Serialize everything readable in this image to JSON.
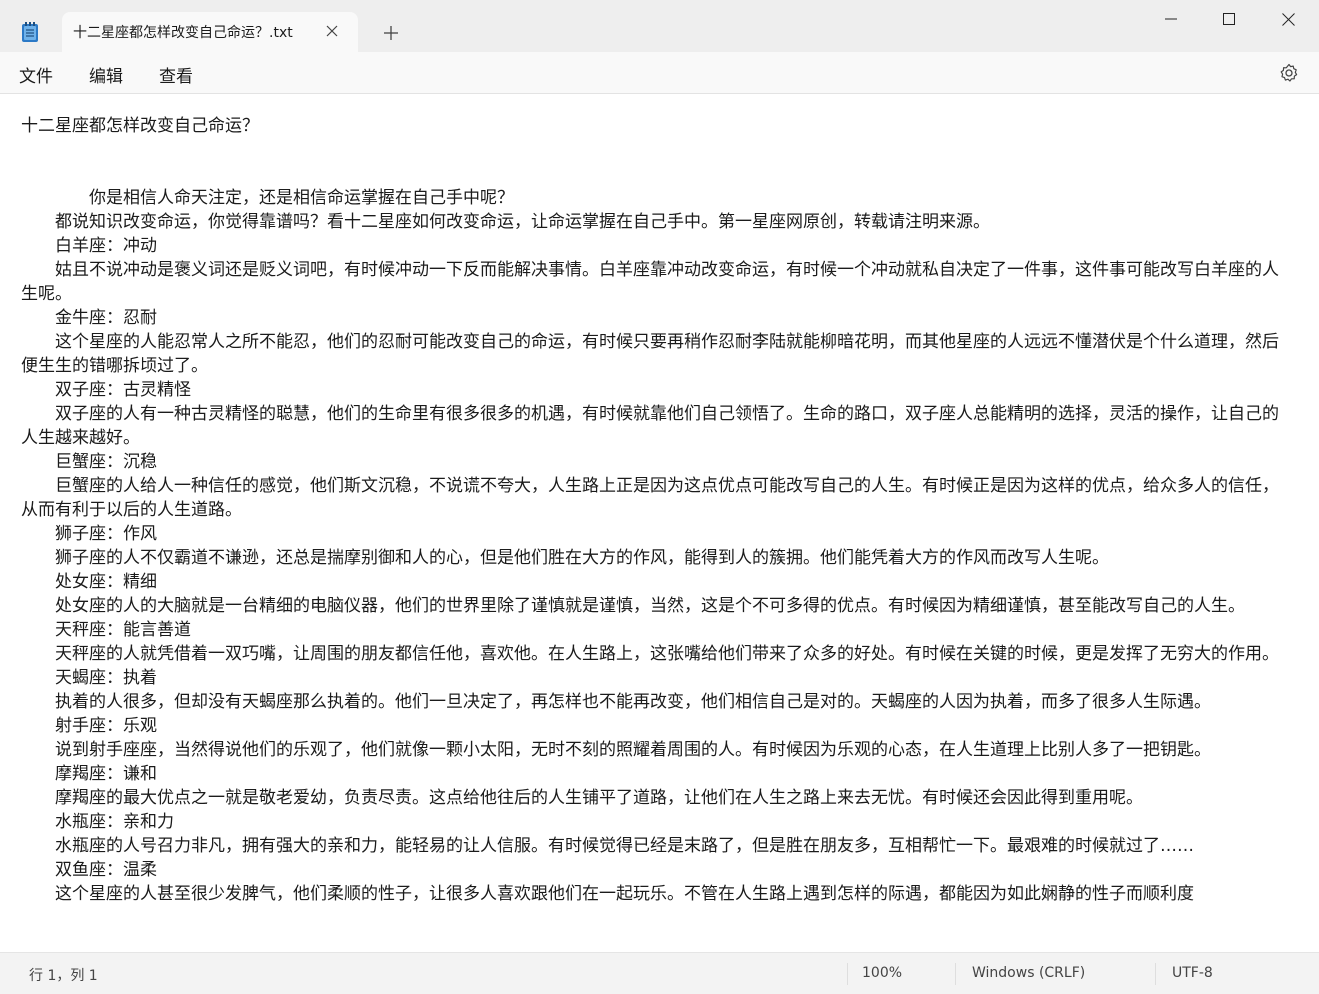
{
  "tab": {
    "title": "十二星座都怎样改变自己命运？.txt"
  },
  "menu": {
    "file": "文件",
    "edit": "编辑",
    "view": "查看"
  },
  "document": {
    "content": "十二星座都怎样改变自己命运？\n\n\n　　　　你是相信人命天注定，还是相信命运掌握在自己手中呢？\n　　都说知识改变命运，你觉得靠谱吗？看十二星座如何改变命运，让命运掌握在自己手中。第一星座网原创，转载请注明来源。\n　　白羊座：冲动\n　　姑且不说冲动是褒义词还是贬义词吧，有时候冲动一下反而能解决事情。白羊座靠冲动改变命运，有时候一个冲动就私自决定了一件事，这件事可能改写白羊座的人生呢。\n　　金牛座：忍耐\n　　这个星座的人能忍常人之所不能忍，他们的忍耐可能改变自己的命运，有时候只要再稍作忍耐李陆就能柳暗花明，而其他星座的人远远不懂潜伏是个什么道理，然后便生生的错哪拆顷过了。\n　　双子座：古灵精怪\n　　双子座的人有一种古灵精怪的聪慧，他们的生命里有很多很多的机遇，有时候就靠他们自己领悟了。生命的路口，双子座人总能精明的选择，灵活的操作，让自己的人生越来越好。\n　　巨蟹座：沉稳\n　　巨蟹座的人给人一种信任的感觉，他们斯文沉稳，不说谎不夸大，人生路上正是因为这点优点可能改写自己的人生。有时候正是因为这样的优点，给众多人的信任，从而有利于以后的人生道路。\n　　狮子座：作风\n　　狮子座的人不仅霸道不谦逊，还总是揣摩别御和人的心，但是他们胜在大方的作风，能得到人的簇拥。他们能凭着大方的作风而改写人生呢。\n　　处女座：精细\n　　处女座的人的大脑就是一台精细的电脑仪器，他们的世界里除了谨慎就是谨慎，当然，这是个不可多得的优点。有时候因为精细谨慎，甚至能改写自己的人生。\n　　天秤座：能言善道\n　　天秤座的人就凭借着一双巧嘴，让周围的朋友都信任他，喜欢他。在人生路上，这张嘴给他们带来了众多的好处。有时候在关键的时候，更是发挥了无穷大的作用。\n　　天蝎座：执着\n　　执着的人很多，但却没有天蝎座那么执着的。他们一旦决定了，再怎样也不能再改变，他们相信自己是对的。天蝎座的人因为执着，而多了很多人生际遇。\n　　射手座：乐观\n　　说到射手座座，当然得说他们的乐观了，他们就像一颗小太阳，无时不刻的照耀着周围的人。有时候因为乐观的心态，在人生道理上比别人多了一把钥匙。\n　　摩羯座：谦和\n　　摩羯座的最大优点之一就是敬老爱幼，负责尽责。这点给他往后的人生铺平了道路，让他们在人生之路上来去无忧。有时候还会因此得到重用呢。\n　　水瓶座：亲和力\n　　水瓶座的人号召力非凡，拥有强大的亲和力，能轻易的让人信服。有时候觉得已经是末路了，但是胜在朋友多，互相帮忙一下。最艰难的时候就过了……\n　　双鱼座：温柔\n　　这个星座的人甚至很少发脾气，他们柔顺的性子，让很多人喜欢跟他们在一起玩乐。不管在人生路上遇到怎样的际遇，都能因为如此娴静的性子而顺利度"
  },
  "status": {
    "position": "行 1，列 1",
    "zoom": "100%",
    "line_ending": "Windows (CRLF)",
    "encoding": "UTF-8"
  },
  "icons": {
    "app": "notepad-icon",
    "close_tab": "close-icon",
    "new_tab": "plus-icon",
    "minimize": "minimize-icon",
    "maximize": "maximize-icon",
    "close_window": "close-icon",
    "settings": "gear-icon"
  }
}
